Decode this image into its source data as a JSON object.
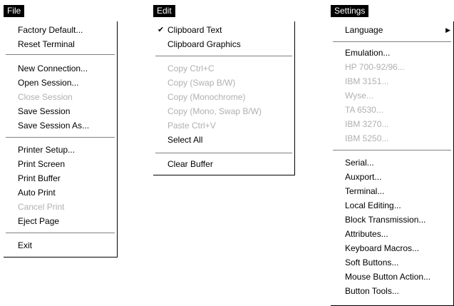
{
  "menus": {
    "file": {
      "title": "File",
      "items": [
        {
          "label": "Factory Default...",
          "enabled": true
        },
        {
          "label": "Reset Terminal",
          "enabled": true
        },
        {
          "separator": true
        },
        {
          "label": "New Connection...",
          "enabled": true
        },
        {
          "label": "Open Session...",
          "enabled": true
        },
        {
          "label": "Close Session",
          "enabled": false
        },
        {
          "label": "Save Session",
          "enabled": true
        },
        {
          "label": "Save Session As...",
          "enabled": true
        },
        {
          "separator": true
        },
        {
          "label": "Printer Setup...",
          "enabled": true
        },
        {
          "label": "Print Screen",
          "enabled": true
        },
        {
          "label": "Print Buffer",
          "enabled": true
        },
        {
          "label": "Auto Print",
          "enabled": true
        },
        {
          "label": "Cancel Print",
          "enabled": false
        },
        {
          "label": "Eject Page",
          "enabled": true
        },
        {
          "separator": true
        },
        {
          "label": "Exit",
          "enabled": true
        }
      ]
    },
    "edit": {
      "title": "Edit",
      "items": [
        {
          "label": "Clipboard Text",
          "enabled": true,
          "checked": true
        },
        {
          "label": "Clipboard Graphics",
          "enabled": true
        },
        {
          "separator": true
        },
        {
          "label": "Copy Ctrl+C",
          "enabled": false
        },
        {
          "label": "Copy (Swap B/W)",
          "enabled": false
        },
        {
          "label": "Copy (Monochrome)",
          "enabled": false
        },
        {
          "label": "Copy (Mono, Swap B/W)",
          "enabled": false
        },
        {
          "label": "Paste Ctrl+V",
          "enabled": false
        },
        {
          "label": "Select All",
          "enabled": true
        },
        {
          "separator": true
        },
        {
          "label": "Clear Buffer",
          "enabled": true
        }
      ]
    },
    "settings": {
      "title": "Settings",
      "items": [
        {
          "label": "Language",
          "enabled": true,
          "submenu": true
        },
        {
          "separator": true
        },
        {
          "label": "Emulation...",
          "enabled": true
        },
        {
          "label": "HP 700-92/96...",
          "enabled": false
        },
        {
          "label": "IBM 3151...",
          "enabled": false
        },
        {
          "label": "Wyse...",
          "enabled": false
        },
        {
          "label": "TA 6530...",
          "enabled": false
        },
        {
          "label": "IBM 3270...",
          "enabled": false
        },
        {
          "label": "IBM 5250...",
          "enabled": false
        },
        {
          "separator": true
        },
        {
          "label": "Serial...",
          "enabled": true
        },
        {
          "label": "Auxport...",
          "enabled": true
        },
        {
          "label": "Terminal...",
          "enabled": true
        },
        {
          "label": "Local Editing...",
          "enabled": true
        },
        {
          "label": "Block Transmission...",
          "enabled": true
        },
        {
          "label": "Attributes...",
          "enabled": true
        },
        {
          "label": "Keyboard Macros...",
          "enabled": true
        },
        {
          "label": "Soft Buttons...",
          "enabled": true
        },
        {
          "label": "Mouse Button Action...",
          "enabled": true
        },
        {
          "label": "Button Tools...",
          "enabled": true
        }
      ]
    }
  },
  "icons": {
    "check": "checkmark-icon",
    "submenu_arrow": "submenu-arrow-icon"
  },
  "colors": {
    "title_bg": "#000000",
    "title_fg": "#ffffff",
    "disabled_text": "#b0b0b0"
  }
}
